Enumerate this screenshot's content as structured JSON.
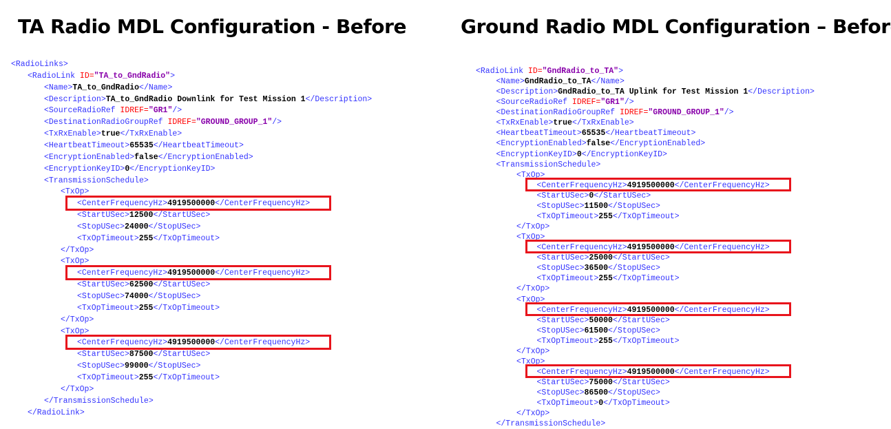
{
  "left": {
    "title": "TA Radio MDL Configuration - Before",
    "lines": [
      {
        "indent": 0,
        "parts": [
          [
            "t",
            "<RadioLinks>"
          ]
        ]
      },
      {
        "indent": 1,
        "parts": [
          [
            "t",
            "<RadioLink "
          ],
          [
            "a",
            "ID="
          ],
          [
            "v",
            "\"TA_to_GndRadio\""
          ],
          [
            "t",
            ">"
          ]
        ]
      },
      {
        "indent": 2,
        "parts": [
          [
            "t",
            "<Name>"
          ],
          [
            "x",
            "TA_to_GndRadio"
          ],
          [
            "t",
            "</Name>"
          ]
        ]
      },
      {
        "indent": 2,
        "parts": [
          [
            "t",
            "<Description>"
          ],
          [
            "x",
            "TA_to_GndRadio Downlink for Test Mission 1"
          ],
          [
            "t",
            "</Description>"
          ]
        ]
      },
      {
        "indent": 2,
        "parts": [
          [
            "t",
            "<SourceRadioRef "
          ],
          [
            "a",
            "IDREF="
          ],
          [
            "v",
            "\"GR1\""
          ],
          [
            "t",
            "/>"
          ]
        ]
      },
      {
        "indent": 2,
        "parts": [
          [
            "t",
            "<DestinationRadioGroupRef "
          ],
          [
            "a",
            "IDREF="
          ],
          [
            "v",
            "\"GROUND_GROUP_1\""
          ],
          [
            "t",
            "/>"
          ]
        ]
      },
      {
        "indent": 2,
        "parts": [
          [
            "t",
            "<TxRxEnable>"
          ],
          [
            "x",
            "true"
          ],
          [
            "t",
            "</TxRxEnable>"
          ]
        ]
      },
      {
        "indent": 2,
        "parts": [
          [
            "t",
            "<HeartbeatTimeout>"
          ],
          [
            "x",
            "65535"
          ],
          [
            "t",
            "</HeartbeatTimeout>"
          ]
        ]
      },
      {
        "indent": 2,
        "parts": [
          [
            "t",
            "<EncryptionEnabled>"
          ],
          [
            "x",
            "false"
          ],
          [
            "t",
            "</EncryptionEnabled>"
          ]
        ]
      },
      {
        "indent": 2,
        "parts": [
          [
            "t",
            "<EncryptionKeyID>"
          ],
          [
            "x",
            "0"
          ],
          [
            "t",
            "</EncryptionKeyID>"
          ]
        ]
      },
      {
        "indent": 2,
        "parts": [
          [
            "t",
            "<TransmissionSchedule>"
          ]
        ]
      },
      {
        "indent": 3,
        "parts": [
          [
            "t",
            "<TxOp>"
          ]
        ]
      },
      {
        "indent": 4,
        "parts": [
          [
            "t",
            "<CenterFrequencyHz>"
          ],
          [
            "x",
            "4919500000"
          ],
          [
            "t",
            "</CenterFrequencyHz>"
          ]
        ],
        "hl": true
      },
      {
        "indent": 4,
        "parts": [
          [
            "t",
            "<StartUSec>"
          ],
          [
            "x",
            "12500"
          ],
          [
            "t",
            "</StartUSec>"
          ]
        ]
      },
      {
        "indent": 4,
        "parts": [
          [
            "t",
            "<StopUSec>"
          ],
          [
            "x",
            "24000"
          ],
          [
            "t",
            "</StopUSec>"
          ]
        ]
      },
      {
        "indent": 4,
        "parts": [
          [
            "t",
            "<TxOpTimeout>"
          ],
          [
            "x",
            "255"
          ],
          [
            "t",
            "</TxOpTimeout>"
          ]
        ]
      },
      {
        "indent": 3,
        "parts": [
          [
            "t",
            "</TxOp>"
          ]
        ]
      },
      {
        "indent": 3,
        "parts": [
          [
            "t",
            "<TxOp>"
          ]
        ]
      },
      {
        "indent": 4,
        "parts": [
          [
            "t",
            "<CenterFrequencyHz>"
          ],
          [
            "x",
            "4919500000"
          ],
          [
            "t",
            "</CenterFrequencyHz>"
          ]
        ],
        "hl": true
      },
      {
        "indent": 4,
        "parts": [
          [
            "t",
            "<StartUSec>"
          ],
          [
            "x",
            "62500"
          ],
          [
            "t",
            "</StartUSec>"
          ]
        ]
      },
      {
        "indent": 4,
        "parts": [
          [
            "t",
            "<StopUSec>"
          ],
          [
            "x",
            "74000"
          ],
          [
            "t",
            "</StopUSec>"
          ]
        ]
      },
      {
        "indent": 4,
        "parts": [
          [
            "t",
            "<TxOpTimeout>"
          ],
          [
            "x",
            "255"
          ],
          [
            "t",
            "</TxOpTimeout>"
          ]
        ]
      },
      {
        "indent": 3,
        "parts": [
          [
            "t",
            "</TxOp>"
          ]
        ]
      },
      {
        "indent": 3,
        "parts": [
          [
            "t",
            "<TxOp>"
          ]
        ]
      },
      {
        "indent": 4,
        "parts": [
          [
            "t",
            "<CenterFrequencyHz>"
          ],
          [
            "x",
            "4919500000"
          ],
          [
            "t",
            "</CenterFrequencyHz>"
          ]
        ],
        "hl": true
      },
      {
        "indent": 4,
        "parts": [
          [
            "t",
            "<StartUSec>"
          ],
          [
            "x",
            "87500"
          ],
          [
            "t",
            "</StartUSec>"
          ]
        ]
      },
      {
        "indent": 4,
        "parts": [
          [
            "t",
            "<StopUSec>"
          ],
          [
            "x",
            "99000"
          ],
          [
            "t",
            "</StopUSec>"
          ]
        ]
      },
      {
        "indent": 4,
        "parts": [
          [
            "t",
            "<TxOpTimeout>"
          ],
          [
            "x",
            "255"
          ],
          [
            "t",
            "</TxOpTimeout>"
          ]
        ]
      },
      {
        "indent": 3,
        "parts": [
          [
            "t",
            "</TxOp>"
          ]
        ]
      },
      {
        "indent": 2,
        "parts": [
          [
            "t",
            "</TransmissionSchedule>"
          ]
        ]
      },
      {
        "indent": 1,
        "parts": [
          [
            "t",
            "</RadioLink>"
          ]
        ]
      }
    ]
  },
  "right": {
    "title": "Ground Radio MDL Configuration – Before",
    "lines": [
      {
        "indent": 0,
        "parts": [
          [
            "t",
            "<RadioLink "
          ],
          [
            "a",
            "ID="
          ],
          [
            "v",
            "\"GndRadio_to_TA\""
          ],
          [
            "t",
            ">"
          ]
        ]
      },
      {
        "indent": 1,
        "parts": [
          [
            "t",
            "<Name>"
          ],
          [
            "x",
            "GndRadio_to_TA"
          ],
          [
            "t",
            "</Name>"
          ]
        ]
      },
      {
        "indent": 1,
        "parts": [
          [
            "t",
            "<Description>"
          ],
          [
            "x",
            "GndRadio_to_TA Uplink for Test Mission 1"
          ],
          [
            "t",
            "</Description>"
          ]
        ]
      },
      {
        "indent": 1,
        "parts": [
          [
            "t",
            "<SourceRadioRef "
          ],
          [
            "a",
            "IDREF="
          ],
          [
            "v",
            "\"GR1\""
          ],
          [
            "t",
            "/>"
          ]
        ]
      },
      {
        "indent": 1,
        "parts": [
          [
            "t",
            "<DestinationRadioGroupRef "
          ],
          [
            "a",
            "IDREF="
          ],
          [
            "v",
            "\"GROUND_GROUP_1\""
          ],
          [
            "t",
            "/>"
          ]
        ]
      },
      {
        "indent": 1,
        "parts": [
          [
            "t",
            "<TxRxEnable>"
          ],
          [
            "x",
            "true"
          ],
          [
            "t",
            "</TxRxEnable>"
          ]
        ]
      },
      {
        "indent": 1,
        "parts": [
          [
            "t",
            "<HeartbeatTimeout>"
          ],
          [
            "x",
            "65535"
          ],
          [
            "t",
            "</HeartbeatTimeout>"
          ]
        ]
      },
      {
        "indent": 1,
        "parts": [
          [
            "t",
            "<EncryptionEnabled>"
          ],
          [
            "x",
            "false"
          ],
          [
            "t",
            "</EncryptionEnabled>"
          ]
        ]
      },
      {
        "indent": 1,
        "parts": [
          [
            "t",
            "<EncryptionKeyID>"
          ],
          [
            "x",
            "0"
          ],
          [
            "t",
            "</EncryptionKeyID>"
          ]
        ]
      },
      {
        "indent": 1,
        "parts": [
          [
            "t",
            "<TransmissionSchedule>"
          ]
        ]
      },
      {
        "indent": 2,
        "parts": [
          [
            "t",
            "<TxOp>"
          ]
        ]
      },
      {
        "indent": 3,
        "parts": [
          [
            "t",
            "<CenterFrequencyHz>"
          ],
          [
            "x",
            "4919500000"
          ],
          [
            "t",
            "</CenterFrequencyHz>"
          ]
        ],
        "hl": true
      },
      {
        "indent": 3,
        "parts": [
          [
            "t",
            "<StartUSec>"
          ],
          [
            "x",
            "0"
          ],
          [
            "t",
            "</StartUSec>"
          ]
        ]
      },
      {
        "indent": 3,
        "parts": [
          [
            "t",
            "<StopUSec>"
          ],
          [
            "x",
            "11500"
          ],
          [
            "t",
            "</StopUSec>"
          ]
        ]
      },
      {
        "indent": 3,
        "parts": [
          [
            "t",
            "<TxOpTimeout>"
          ],
          [
            "x",
            "255"
          ],
          [
            "t",
            "</TxOpTimeout>"
          ]
        ]
      },
      {
        "indent": 2,
        "parts": [
          [
            "t",
            "</TxOp>"
          ]
        ]
      },
      {
        "indent": 2,
        "parts": [
          [
            "t",
            "<TxOp>"
          ]
        ]
      },
      {
        "indent": 3,
        "parts": [
          [
            "t",
            "<CenterFrequencyHz>"
          ],
          [
            "x",
            "4919500000"
          ],
          [
            "t",
            "</CenterFrequencyHz>"
          ]
        ],
        "hl": true
      },
      {
        "indent": 3,
        "parts": [
          [
            "t",
            "<StartUSec>"
          ],
          [
            "x",
            "25000"
          ],
          [
            "t",
            "</StartUSec>"
          ]
        ]
      },
      {
        "indent": 3,
        "parts": [
          [
            "t",
            "<StopUSec>"
          ],
          [
            "x",
            "36500"
          ],
          [
            "t",
            "</StopUSec>"
          ]
        ]
      },
      {
        "indent": 3,
        "parts": [
          [
            "t",
            "<TxOpTimeout>"
          ],
          [
            "x",
            "255"
          ],
          [
            "t",
            "</TxOpTimeout>"
          ]
        ]
      },
      {
        "indent": 2,
        "parts": [
          [
            "t",
            "</TxOp>"
          ]
        ]
      },
      {
        "indent": 2,
        "parts": [
          [
            "t",
            "<TxOp>"
          ]
        ]
      },
      {
        "indent": 3,
        "parts": [
          [
            "t",
            "<CenterFrequencyHz>"
          ],
          [
            "x",
            "4919500000"
          ],
          [
            "t",
            "</CenterFrequencyHz>"
          ]
        ],
        "hl": true
      },
      {
        "indent": 3,
        "parts": [
          [
            "t",
            "<StartUSec>"
          ],
          [
            "x",
            "50000"
          ],
          [
            "t",
            "</StartUSec>"
          ]
        ]
      },
      {
        "indent": 3,
        "parts": [
          [
            "t",
            "<StopUSec>"
          ],
          [
            "x",
            "61500"
          ],
          [
            "t",
            "</StopUSec>"
          ]
        ]
      },
      {
        "indent": 3,
        "parts": [
          [
            "t",
            "<TxOpTimeout>"
          ],
          [
            "x",
            "255"
          ],
          [
            "t",
            "</TxOpTimeout>"
          ]
        ]
      },
      {
        "indent": 2,
        "parts": [
          [
            "t",
            "</TxOp>"
          ]
        ]
      },
      {
        "indent": 2,
        "parts": [
          [
            "t",
            "<TxOp>"
          ]
        ]
      },
      {
        "indent": 3,
        "parts": [
          [
            "t",
            "<CenterFrequencyHz>"
          ],
          [
            "x",
            "4919500000"
          ],
          [
            "t",
            "</CenterFrequencyHz>"
          ]
        ],
        "hl": true
      },
      {
        "indent": 3,
        "parts": [
          [
            "t",
            "<StartUSec>"
          ],
          [
            "x",
            "75000"
          ],
          [
            "t",
            "</StartUSec>"
          ]
        ]
      },
      {
        "indent": 3,
        "parts": [
          [
            "t",
            "<StopUSec>"
          ],
          [
            "x",
            "86500"
          ],
          [
            "t",
            "</StopUSec>"
          ]
        ]
      },
      {
        "indent": 3,
        "parts": [
          [
            "t",
            "<TxOpTimeout>"
          ],
          [
            "x",
            "0"
          ],
          [
            "t",
            "</TxOpTimeout>"
          ]
        ]
      },
      {
        "indent": 2,
        "parts": [
          [
            "t",
            "</TxOp>"
          ]
        ]
      },
      {
        "indent": 1,
        "parts": [
          [
            "t",
            "</TransmissionSchedule>"
          ]
        ]
      }
    ]
  }
}
